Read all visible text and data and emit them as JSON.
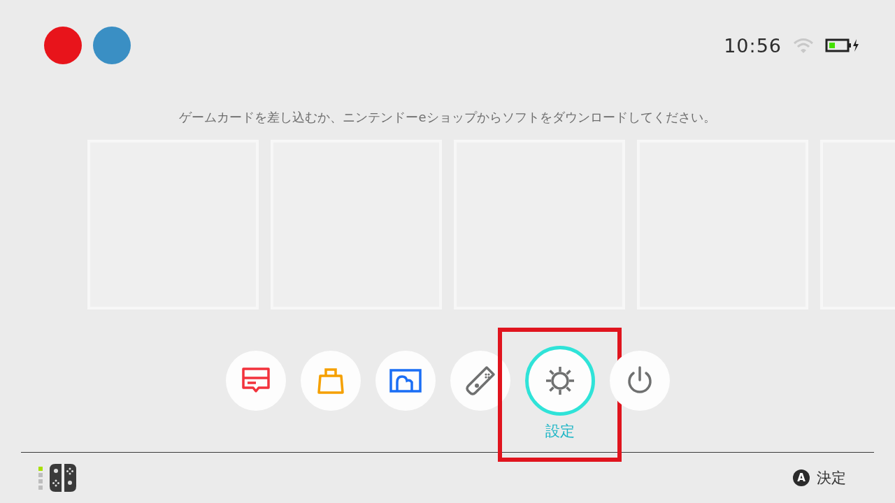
{
  "users": [
    {
      "kind": "avatar"
    },
    {
      "kind": "avatar"
    }
  ],
  "status": {
    "time": "10:56"
  },
  "message": "ゲームカードを差し込むか、ニンテンドーeショップからソフトをダウンロードしてください。",
  "game_slots": [
    {
      "kind": "empty"
    },
    {
      "kind": "empty"
    },
    {
      "kind": "empty"
    },
    {
      "kind": "empty"
    },
    {
      "kind": "empty"
    }
  ],
  "dock": {
    "frame_on_selected": true,
    "items": [
      {
        "kind": "news",
        "selected": false
      },
      {
        "kind": "shop",
        "selected": false
      },
      {
        "kind": "album",
        "selected": false
      },
      {
        "kind": "controllers",
        "selected": false
      },
      {
        "kind": "settings",
        "selected": true,
        "label": "設定"
      },
      {
        "kind": "power",
        "selected": false
      }
    ]
  },
  "footer": {
    "player_lights": [
      {
        "on": true
      },
      {
        "on": false
      },
      {
        "on": false
      },
      {
        "on": false
      }
    ],
    "hint": {
      "button": "A",
      "label": "決定"
    }
  }
}
